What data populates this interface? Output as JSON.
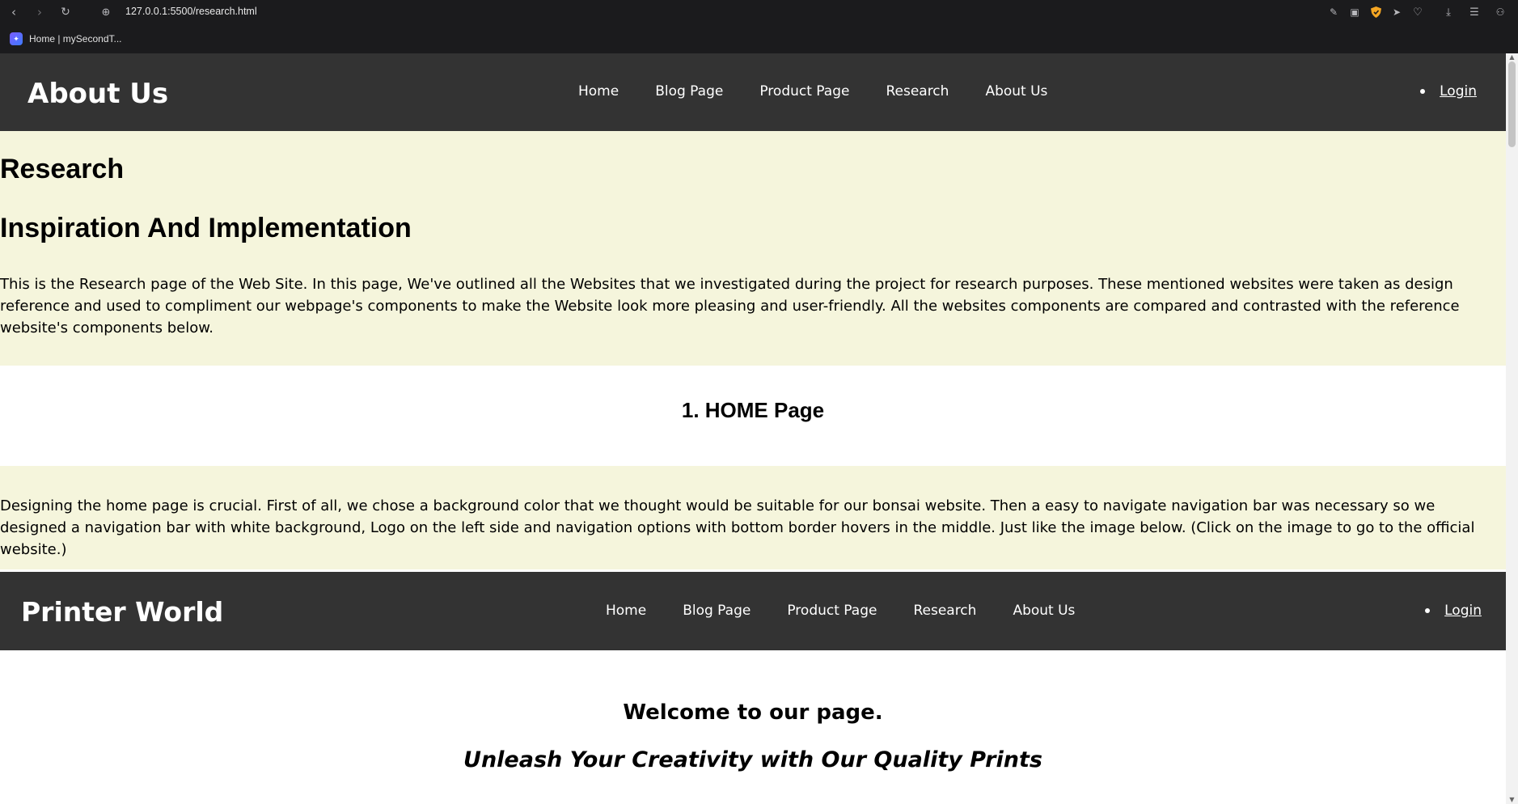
{
  "browser": {
    "url": "127.0.0.1:5500/research.html",
    "bookmark_label": "Home | mySecondT..."
  },
  "navbar": {
    "logo": "About Us",
    "links": [
      "Home",
      "Blog Page",
      "Product Page",
      "Research",
      "About Us"
    ],
    "login": "Login"
  },
  "intro": {
    "title": "Research",
    "subtitle": "Inspiration And Implementation",
    "text": "This is the Research page of the Web Site. In this page, We've outlined all the Websites that we investigated during the project for research purposes. These mentioned websites were taken as design reference and used to compliment our webpage's components to make the Website look more pleasing and user-friendly. All the websites components are compared and contrasted with the reference website's components below."
  },
  "home_section": {
    "heading": "1. HOME Page",
    "text": "Designing the home page is crucial. First of all, we chose a background color that we thought would be suitable for our bonsai website. Then a easy to navigate navigation bar was necessary so we designed a navigation bar with white background, Logo on the left side and navigation options with bottom border hovers in the middle. Just like the image below. (Click on the image to go to the official website.)"
  },
  "reference": {
    "logo": "Printer World",
    "links": [
      "Home",
      "Blog Page",
      "Product Page",
      "Research",
      "About Us"
    ],
    "login": "Login",
    "welcome": "Welcome to our page.",
    "tagline": "Unleash Your Creativity with Our Quality Prints"
  },
  "colors": {
    "navbar_bg": "#333333",
    "beige_bg": "#f5f5dc",
    "chrome_bg": "#1b1b1d"
  },
  "icons": [
    "back-icon",
    "forward-icon",
    "reload-icon",
    "site-info-icon",
    "edit-icon",
    "camera-icon",
    "shield-icon",
    "send-icon",
    "heart-icon",
    "download-icon",
    "menu-icon",
    "profile-icon"
  ]
}
